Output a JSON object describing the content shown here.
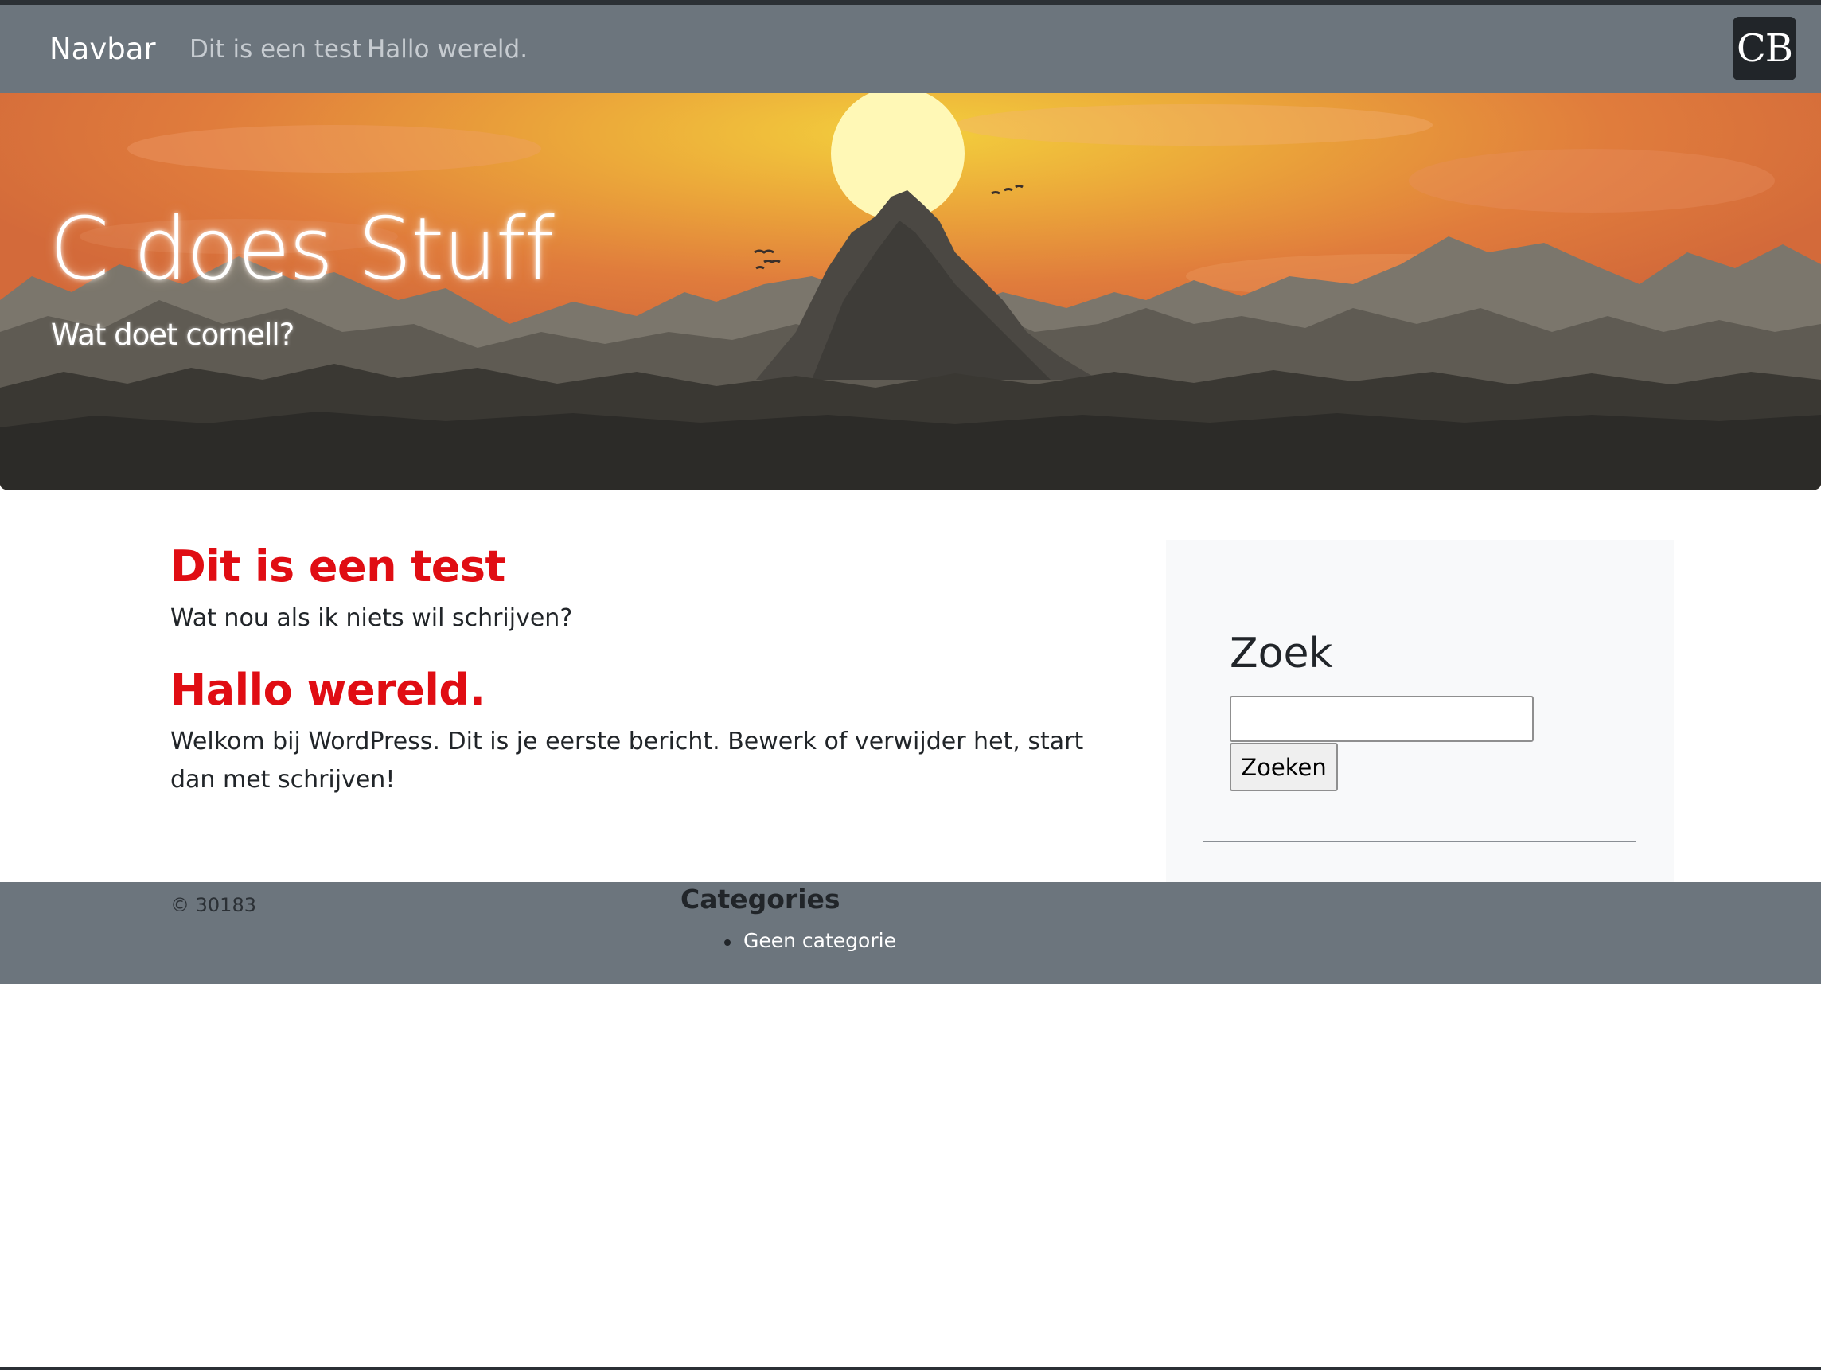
{
  "navbar": {
    "brand": "Navbar",
    "links": [
      "Dit is een test",
      "Hallo wereld."
    ],
    "logo_text": "CB",
    "background": "#6c757d"
  },
  "hero": {
    "title": "C does Stuff",
    "subtitle": "Wat doet cornell?"
  },
  "posts": [
    {
      "title": "Dit is een test",
      "body": "Wat nou als ik niets wil schrijven?"
    },
    {
      "title": "Hallo wereld.",
      "body": "Welkom bij WordPress. Dit is je eerste bericht. Bewerk of verwijder het, start dan met schrijven!"
    }
  ],
  "sidebar": {
    "search_title": "Zoek",
    "search_value": "",
    "search_button": "Zoeken"
  },
  "footer": {
    "copyright": "© 30183",
    "categories_title": "Categories",
    "categories": [
      "Geen categorie"
    ]
  },
  "colors": {
    "post_title": "#e00d13",
    "footer_bg": "#6c757d",
    "sidebar_bg": "#f8f9fa"
  },
  "icons": {
    "logo": "cb-logo-icon"
  }
}
